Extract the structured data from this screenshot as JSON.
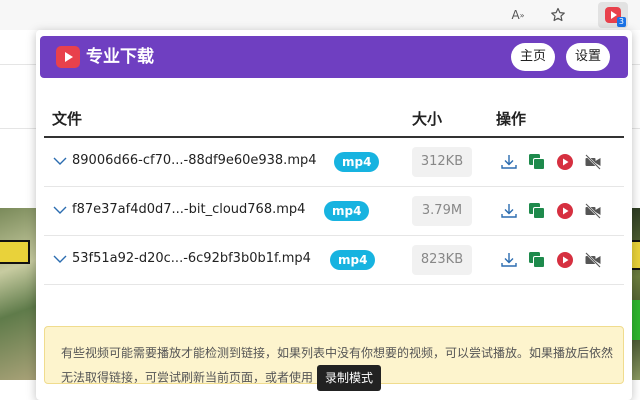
{
  "browser": {
    "read_aloud_label": "A",
    "read_aloud_sup": "»",
    "extension_badge": "3"
  },
  "popup": {
    "title": "专业下载",
    "home_button": "主页",
    "settings_button": "设置",
    "columns": {
      "file": "文件",
      "size": "大小",
      "action": "操作"
    },
    "files": [
      {
        "name": "89006d66-cf70...-88df9e60e938.mp4",
        "type": "mp4",
        "size": "312KB"
      },
      {
        "name": "f87e37af4d0d7...-bit_cloud768.mp4",
        "type": "mp4",
        "size": "3.79M"
      },
      {
        "name": "53f51a92-d20c...-6c92bf3b0b1f.mp4",
        "type": "mp4",
        "size": "823KB"
      }
    ],
    "notice": {
      "text": "有些视频可能需要播放才能检测到链接，如果列表中没有你想要的视频，可以尝试播放。如果播放后依然无法取得链接，可尝试刷新当前页面，或者使用",
      "record_button": "录制模式"
    }
  },
  "colors": {
    "header_bg": "#6f3fc1",
    "logo_red": "#e8414c",
    "tag_blue": "#17b3e0",
    "download_icon": "#2b6cb0",
    "copy_icon": "#1e8a4c",
    "play_icon": "#d63040",
    "notice_bg": "#fdf4cd"
  }
}
